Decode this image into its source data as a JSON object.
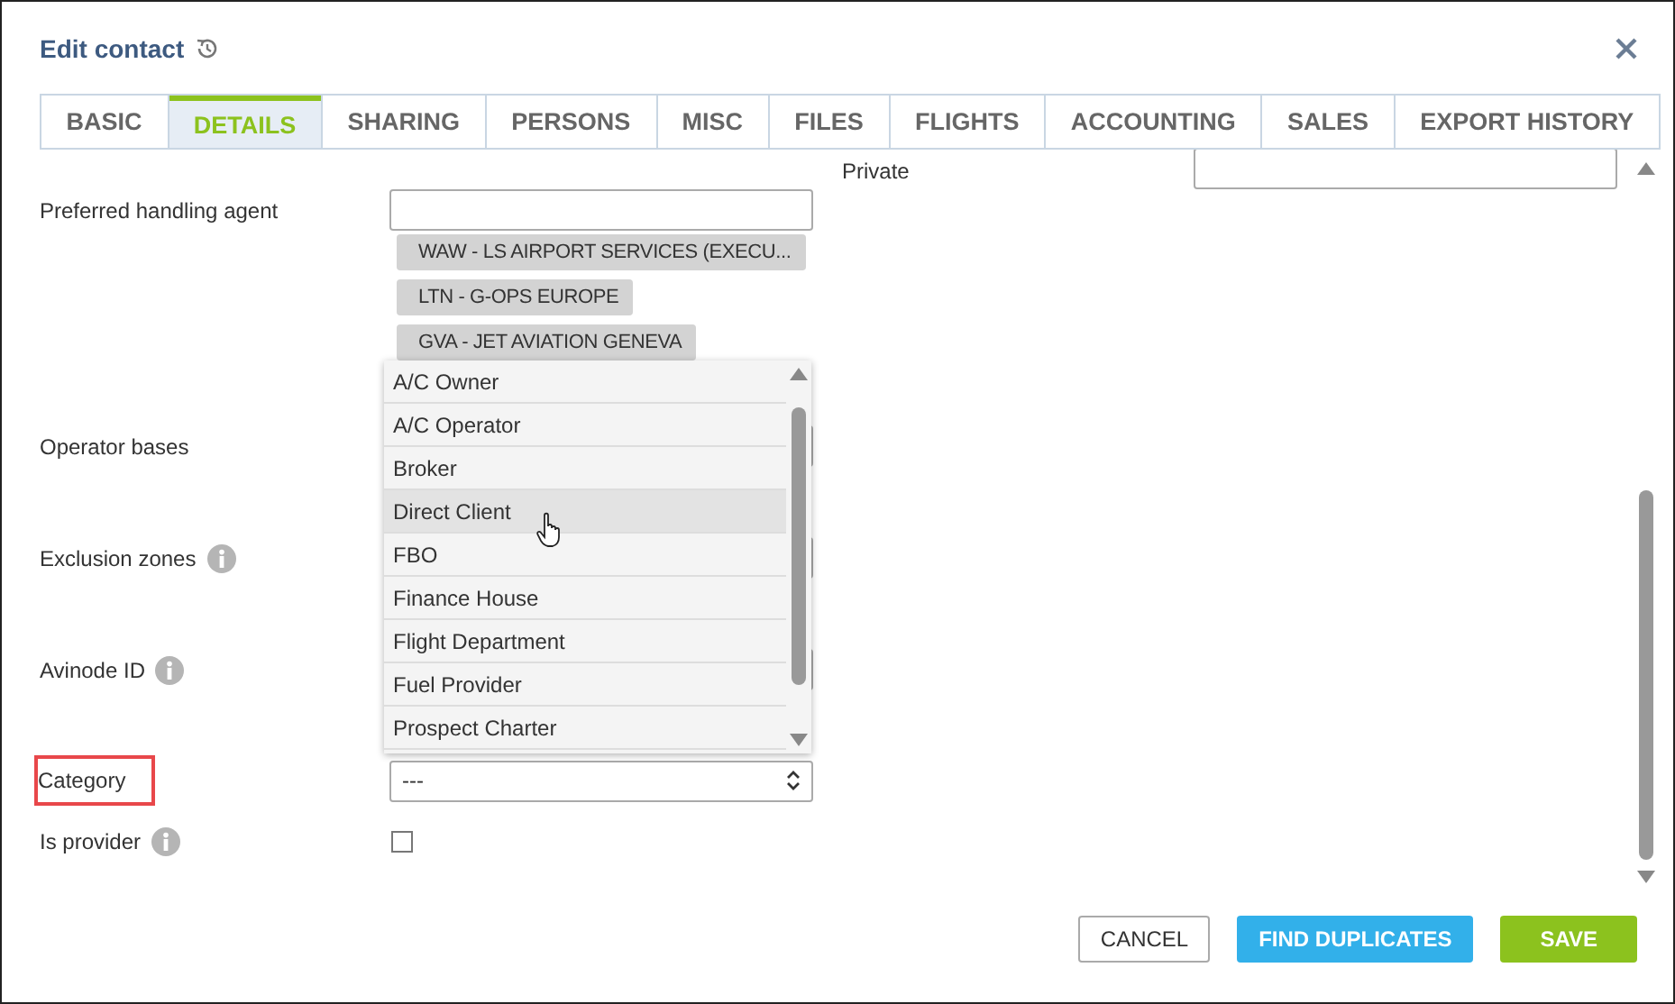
{
  "dialog": {
    "title": "Edit contact"
  },
  "tabs": [
    {
      "label": "BASIC",
      "selected": false
    },
    {
      "label": "DETAILS",
      "selected": true
    },
    {
      "label": "SHARING",
      "selected": false
    },
    {
      "label": "PERSONS",
      "selected": false
    },
    {
      "label": "MISC",
      "selected": false
    },
    {
      "label": "FILES",
      "selected": false
    },
    {
      "label": "FLIGHTS",
      "selected": false
    },
    {
      "label": "ACCOUNTING",
      "selected": false
    },
    {
      "label": "SALES",
      "selected": false
    },
    {
      "label": "EXPORT HISTORY",
      "selected": false
    }
  ],
  "private_field": {
    "label": "Private"
  },
  "form_rows": [
    {
      "kind": "tags",
      "label": "Preferred handling agent",
      "info": false,
      "highlighted": false,
      "tags": [
        "WAW - LS AIRPORT SERVICES (EXECU...",
        "LTN - G-OPS EUROPE",
        "GVA - JET AVIATION GENEVA"
      ]
    },
    {
      "kind": "input",
      "label": "Operator bases",
      "info": false,
      "highlighted": false
    },
    {
      "kind": "input",
      "label": "Exclusion zones",
      "info": true,
      "highlighted": false
    },
    {
      "kind": "input",
      "label": "Avinode ID",
      "info": true,
      "highlighted": false
    },
    {
      "kind": "select",
      "label": "Category",
      "info": false,
      "highlighted": true,
      "value": "---"
    },
    {
      "kind": "checkbox",
      "label": "Is provider",
      "info": true,
      "highlighted": false,
      "checked": false
    }
  ],
  "category_dropdown": {
    "options": [
      {
        "label": "A/C Owner",
        "hovered": false
      },
      {
        "label": "A/C Operator",
        "hovered": false
      },
      {
        "label": "Broker",
        "hovered": false
      },
      {
        "label": "Direct Client",
        "hovered": true
      },
      {
        "label": "FBO",
        "hovered": false
      },
      {
        "label": "Finance House",
        "hovered": false
      },
      {
        "label": "Flight Department",
        "hovered": false
      },
      {
        "label": "Fuel Provider",
        "hovered": false
      },
      {
        "label": "Prospect Charter",
        "hovered": false
      }
    ]
  },
  "buttons": [
    {
      "kind": "cancel",
      "label": "CANCEL"
    },
    {
      "kind": "find",
      "label": "FIND DUPLICATES"
    },
    {
      "kind": "save",
      "label": "SAVE"
    }
  ]
}
